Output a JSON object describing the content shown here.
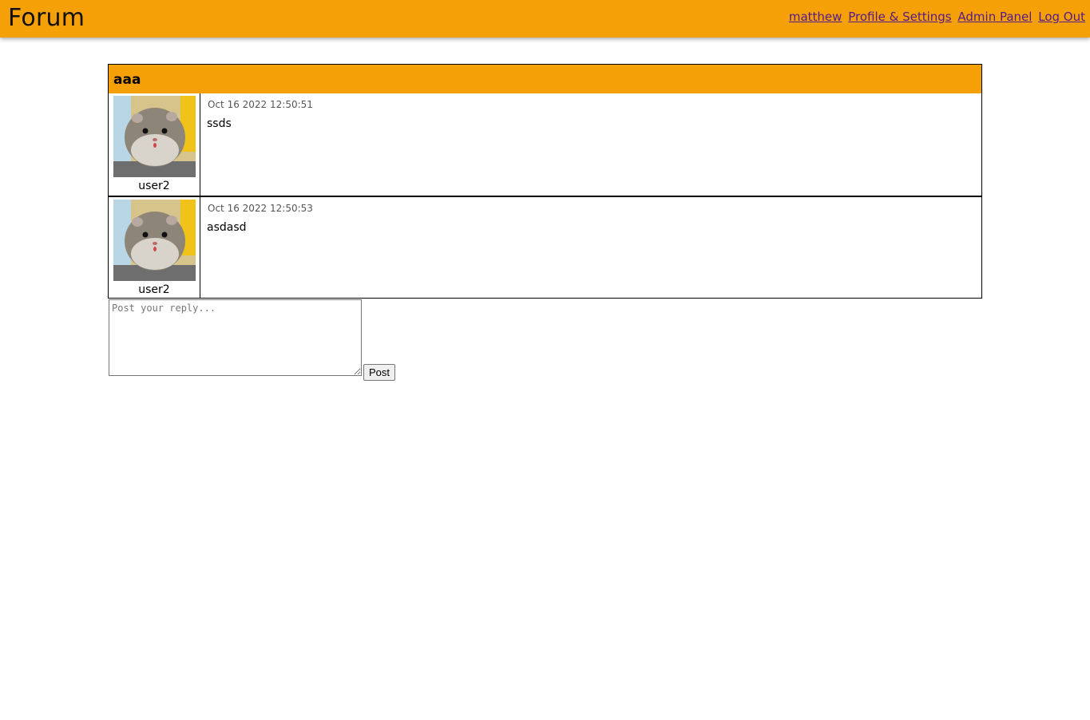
{
  "header": {
    "brand": "Forum",
    "nav": [
      {
        "label": "matthew"
      },
      {
        "label": "Profile & Settings"
      },
      {
        "label": "Admin Panel"
      },
      {
        "label": "Log Out"
      }
    ]
  },
  "thread": {
    "title": "aaa",
    "posts": [
      {
        "author": "user2",
        "timestamp": "Oct 16 2022 12:50:51",
        "content": "ssds"
      },
      {
        "author": "user2",
        "timestamp": "Oct 16 2022 12:50:53",
        "content": "asdasd"
      }
    ]
  },
  "reply": {
    "placeholder": "Post your reply...",
    "button_label": "Post"
  },
  "colors": {
    "accent": "#f5a006",
    "link": "#551a8b"
  }
}
